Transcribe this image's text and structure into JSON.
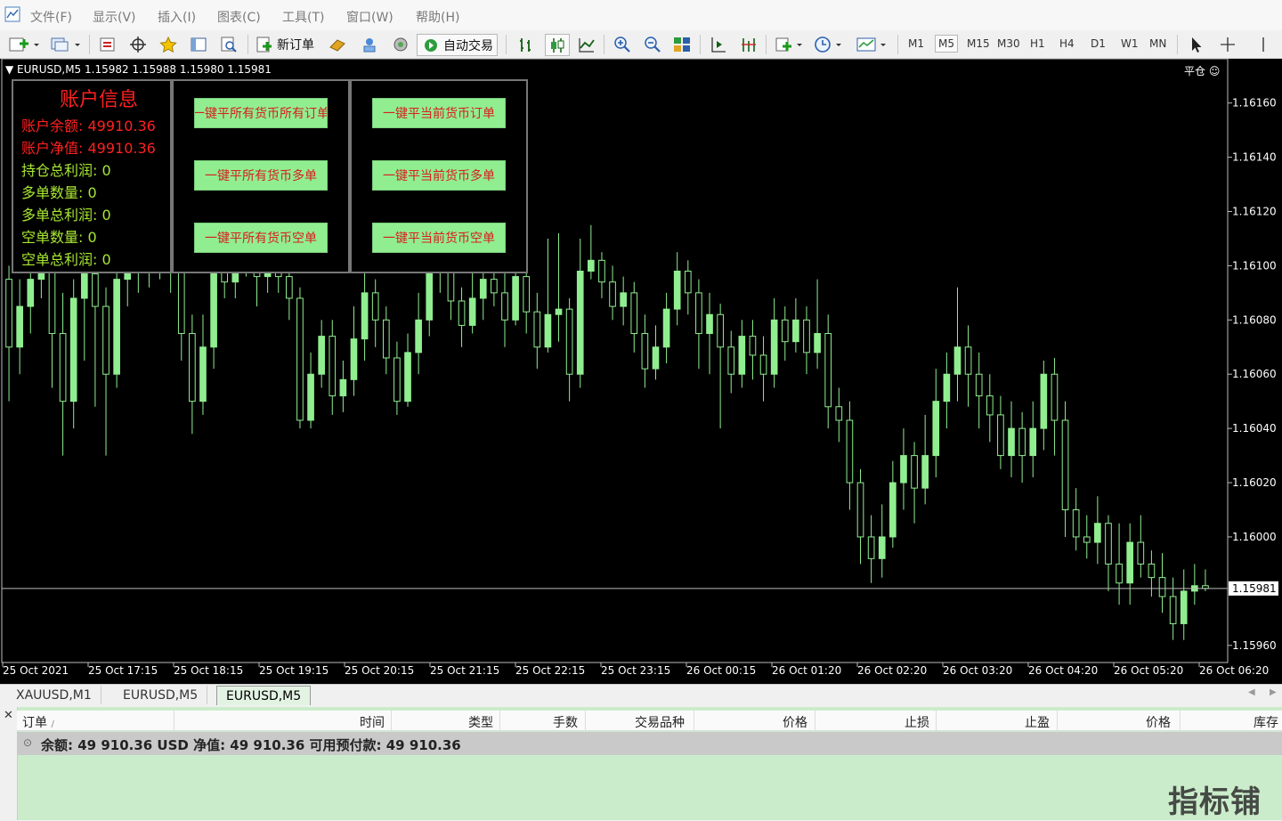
{
  "menu": {
    "items": [
      "文件(F)",
      "显示(V)",
      "插入(I)",
      "图表(C)",
      "工具(T)",
      "窗口(W)",
      "帮助(H)"
    ]
  },
  "toolbar": {
    "new_order_label": "新订单",
    "auto_trade_label": "自动交易",
    "timeframes": [
      "M1",
      "M5",
      "M15",
      "M30",
      "H1",
      "H4",
      "D1",
      "W1",
      "MN"
    ],
    "active_timeframe": "M5"
  },
  "chart": {
    "symbol_line": "EURUSD,M5  1.15982 1.15988 1.15980 1.15981",
    "close_label": "平仓",
    "current_price_label": "1.15981",
    "current_price": 1.15981,
    "bull_color": "#90ee90",
    "bear_color": "#000000",
    "wick_color": "#90ee90"
  },
  "account_panel": {
    "title": "账户信息",
    "balance": "账户余额: 49910.36",
    "equity": "账户净值: 49910.36",
    "total_profit": "持仓总利润: 0",
    "buy_count": "多单数量: 0",
    "buy_profit": "多单总利润: 0",
    "sell_count": "空单数量: 0",
    "sell_profit": "空单总利润: 0",
    "title_color": "#ff2020",
    "red_color": "#ff2020",
    "green_color": "#a8e832"
  },
  "buttons": {
    "close_all_orders": "一键平所有货币所有订单",
    "close_all_buy": "一键平所有货币多单",
    "close_all_sell": "一键平所有货币空单",
    "close_cur_orders": "一键平当前货币订单",
    "close_cur_buy": "一键平当前货币多单",
    "close_cur_sell": "一键平当前货币空单"
  },
  "tabs": [
    {
      "label": "XAUUSD,M1"
    },
    {
      "label": "EURUSD,M5"
    },
    {
      "label": "EURUSD,M5"
    }
  ],
  "active_tab": 2,
  "terminal": {
    "columns": [
      "订单",
      "时间",
      "类型",
      "手数",
      "交易品种",
      "价格",
      "止损",
      "止盈",
      "价格",
      "库存"
    ],
    "sort_marker": "/",
    "balance_line": "余额: 49 910.36 USD  净值: 49 910.36  可用预付款: 49 910.36"
  },
  "watermark": "指标铺",
  "chart_data": {
    "type": "candlestick",
    "y_ticks": [
      1.1616,
      1.1614,
      1.1612,
      1.161,
      1.1608,
      1.1606,
      1.1604,
      1.1602,
      1.16,
      1.1596
    ],
    "y_tick_labels": [
      "1.16160",
      "1.16140",
      "1.16120",
      "1.16100",
      "1.16080",
      "1.16060",
      "1.16040",
      "1.16020",
      "1.16000",
      "1.15960"
    ],
    "x_tick_labels": [
      "25 Oct 2021",
      "25 Oct 17:15",
      "25 Oct 18:15",
      "25 Oct 19:15",
      "25 Oct 20:15",
      "25 Oct 21:15",
      "25 Oct 22:15",
      "25 Oct 23:15",
      "26 Oct 00:15",
      "26 Oct 01:20",
      "26 Oct 02:20",
      "26 Oct 03:20",
      "26 Oct 04:20",
      "26 Oct 05:20",
      "26 Oct 06:20"
    ],
    "y_range": [
      1.15955,
      1.16175
    ],
    "candles": [
      [
        1.16095,
        1.1607,
        1.161,
        1.1605
      ],
      [
        1.1607,
        1.16085,
        1.16095,
        1.1606
      ],
      [
        1.16085,
        1.16095,
        1.16105,
        1.16075
      ],
      [
        1.16095,
        1.161,
        1.1611,
        1.16088
      ],
      [
        1.161,
        1.16075,
        1.16108,
        1.16055
      ],
      [
        1.16075,
        1.1605,
        1.1609,
        1.1603
      ],
      [
        1.1605,
        1.16088,
        1.16095,
        1.1604
      ],
      [
        1.16088,
        1.16097,
        1.1611,
        1.16065
      ],
      [
        1.16097,
        1.16085,
        1.16105,
        1.16048
      ],
      [
        1.16085,
        1.1606,
        1.16092,
        1.1603
      ],
      [
        1.1606,
        1.16095,
        1.161,
        1.16055
      ],
      [
        1.16095,
        1.16101,
        1.16112,
        1.16085
      ],
      [
        1.16101,
        1.16098,
        1.1611,
        1.1609
      ],
      [
        1.16098,
        1.16104,
        1.1611,
        1.16092
      ],
      [
        1.16104,
        1.16102,
        1.16112,
        1.16095
      ],
      [
        1.16102,
        1.161,
        1.16108,
        1.1609
      ],
      [
        1.161,
        1.16075,
        1.16104,
        1.16065
      ],
      [
        1.16075,
        1.1605,
        1.16082,
        1.16038
      ],
      [
        1.1605,
        1.1607,
        1.16082,
        1.16045
      ],
      [
        1.1607,
        1.161,
        1.16108,
        1.16062
      ],
      [
        1.161,
        1.16094,
        1.1611,
        1.16088
      ],
      [
        1.16094,
        1.16105,
        1.16112,
        1.16088
      ],
      [
        1.16105,
        1.16102,
        1.1611,
        1.16096
      ],
      [
        1.16102,
        1.16096,
        1.16104,
        1.16085
      ],
      [
        1.16096,
        1.16103,
        1.1611,
        1.1609
      ],
      [
        1.16103,
        1.16096,
        1.16106,
        1.1609
      ],
      [
        1.16096,
        1.16088,
        1.161,
        1.1608
      ],
      [
        1.16088,
        1.16043,
        1.16092,
        1.1604
      ],
      [
        1.16043,
        1.1606,
        1.16068,
        1.1604
      ],
      [
        1.1606,
        1.16074,
        1.1608,
        1.16055
      ],
      [
        1.16074,
        1.16052,
        1.1608,
        1.16045
      ],
      [
        1.16052,
        1.16058,
        1.16065,
        1.16046
      ],
      [
        1.16058,
        1.16073,
        1.16085,
        1.16052
      ],
      [
        1.16073,
        1.1609,
        1.161,
        1.16065
      ],
      [
        1.1609,
        1.1608,
        1.16095,
        1.1607
      ],
      [
        1.1608,
        1.16066,
        1.16085,
        1.1606
      ],
      [
        1.16066,
        1.1605,
        1.16072,
        1.16045
      ],
      [
        1.1605,
        1.16068,
        1.16075,
        1.16048
      ],
      [
        1.16068,
        1.1608,
        1.1609,
        1.1606
      ],
      [
        1.1608,
        1.161,
        1.16108,
        1.16074
      ],
      [
        1.161,
        1.16098,
        1.16105,
        1.1609
      ],
      [
        1.16098,
        1.16087,
        1.161,
        1.1608
      ],
      [
        1.16087,
        1.16078,
        1.16092,
        1.1607
      ],
      [
        1.16078,
        1.16088,
        1.16102,
        1.16075
      ],
      [
        1.16088,
        1.16095,
        1.16108,
        1.1608
      ],
      [
        1.16095,
        1.1609,
        1.16105,
        1.16085
      ],
      [
        1.1609,
        1.1608,
        1.16098,
        1.1607
      ],
      [
        1.1608,
        1.16096,
        1.16102,
        1.16078
      ],
      [
        1.16096,
        1.16083,
        1.161,
        1.16075
      ],
      [
        1.16083,
        1.1607,
        1.1609,
        1.16062
      ],
      [
        1.1607,
        1.16082,
        1.1611,
        1.16068
      ],
      [
        1.16082,
        1.16084,
        1.16112,
        1.16072
      ],
      [
        1.16084,
        1.1606,
        1.16088,
        1.1605
      ],
      [
        1.1606,
        1.16098,
        1.1611,
        1.16055
      ],
      [
        1.16098,
        1.16102,
        1.16115,
        1.16095
      ],
      [
        1.16102,
        1.16094,
        1.16105,
        1.16088
      ],
      [
        1.16094,
        1.16085,
        1.161,
        1.1608
      ],
      [
        1.16085,
        1.1609,
        1.16096,
        1.16078
      ],
      [
        1.1609,
        1.16075,
        1.16094,
        1.16068
      ],
      [
        1.16075,
        1.16062,
        1.16082,
        1.16055
      ],
      [
        1.16062,
        1.1607,
        1.16078,
        1.16058
      ],
      [
        1.1607,
        1.16084,
        1.1609,
        1.16064
      ],
      [
        1.16084,
        1.16098,
        1.16105,
        1.16078
      ],
      [
        1.16098,
        1.1609,
        1.16102,
        1.16082
      ],
      [
        1.1609,
        1.16075,
        1.16095,
        1.16062
      ],
      [
        1.16075,
        1.16082,
        1.1609,
        1.1606
      ],
      [
        1.16082,
        1.1607,
        1.16086,
        1.1604
      ],
      [
        1.1607,
        1.1606,
        1.16076,
        1.16053
      ],
      [
        1.1606,
        1.16074,
        1.1608,
        1.16055
      ],
      [
        1.16074,
        1.16067,
        1.1608,
        1.16058
      ],
      [
        1.16067,
        1.1606,
        1.16074,
        1.1605
      ],
      [
        1.1606,
        1.1608,
        1.16088,
        1.16055
      ],
      [
        1.1608,
        1.16072,
        1.16085,
        1.16065
      ],
      [
        1.16072,
        1.1608,
        1.16088,
        1.16068
      ],
      [
        1.1608,
        1.16068,
        1.16085,
        1.1606
      ],
      [
        1.16068,
        1.16075,
        1.16095,
        1.16062
      ],
      [
        1.16075,
        1.16048,
        1.16082,
        1.1604
      ],
      [
        1.16048,
        1.16043,
        1.16055,
        1.16035
      ],
      [
        1.16043,
        1.1602,
        1.1605,
        1.1601
      ],
      [
        1.1602,
        1.16,
        1.16025,
        1.1599
      ],
      [
        1.16,
        1.15992,
        1.16008,
        1.15983
      ],
      [
        1.15992,
        1.16,
        1.16012,
        1.15985
      ],
      [
        1.16,
        1.1602,
        1.16028,
        1.15996
      ],
      [
        1.1602,
        1.1603,
        1.1604,
        1.1601
      ],
      [
        1.1603,
        1.16018,
        1.16035,
        1.16005
      ],
      [
        1.16018,
        1.1603,
        1.16045,
        1.16012
      ],
      [
        1.1603,
        1.1605,
        1.16062,
        1.16022
      ],
      [
        1.1605,
        1.1606,
        1.16068,
        1.1604
      ],
      [
        1.1606,
        1.1607,
        1.16092,
        1.1605
      ],
      [
        1.1607,
        1.1606,
        1.16078,
        1.16048
      ],
      [
        1.1606,
        1.16052,
        1.16068,
        1.1604
      ],
      [
        1.16052,
        1.16045,
        1.1606,
        1.16035
      ],
      [
        1.16045,
        1.1603,
        1.16052,
        1.16025
      ],
      [
        1.1603,
        1.1604,
        1.1605,
        1.16022
      ],
      [
        1.1604,
        1.1603,
        1.16046,
        1.1602
      ],
      [
        1.1603,
        1.1604,
        1.1605,
        1.16022
      ],
      [
        1.1604,
        1.1606,
        1.16065,
        1.16032
      ],
      [
        1.1606,
        1.16043,
        1.16066,
        1.1603
      ],
      [
        1.16043,
        1.1601,
        1.1605,
        1.16
      ],
      [
        1.1601,
        1.16,
        1.16018,
        1.15995
      ],
      [
        1.16,
        1.15998,
        1.16008,
        1.15992
      ],
      [
        1.15998,
        1.16005,
        1.16015,
        1.1599
      ],
      [
        1.16005,
        1.1599,
        1.16008,
        1.1598
      ],
      [
        1.1599,
        1.15983,
        1.16005,
        1.15975
      ],
      [
        1.15983,
        1.15998,
        1.16005,
        1.15975
      ],
      [
        1.15998,
        1.1599,
        1.16008,
        1.15985
      ],
      [
        1.1599,
        1.15985,
        1.15995,
        1.15978
      ],
      [
        1.15985,
        1.15978,
        1.15994,
        1.15972
      ],
      [
        1.15978,
        1.15968,
        1.15985,
        1.15962
      ],
      [
        1.15968,
        1.1598,
        1.15988,
        1.15962
      ],
      [
        1.1598,
        1.15982,
        1.1599,
        1.15975
      ],
      [
        1.15982,
        1.15981,
        1.15988,
        1.1598
      ]
    ]
  }
}
